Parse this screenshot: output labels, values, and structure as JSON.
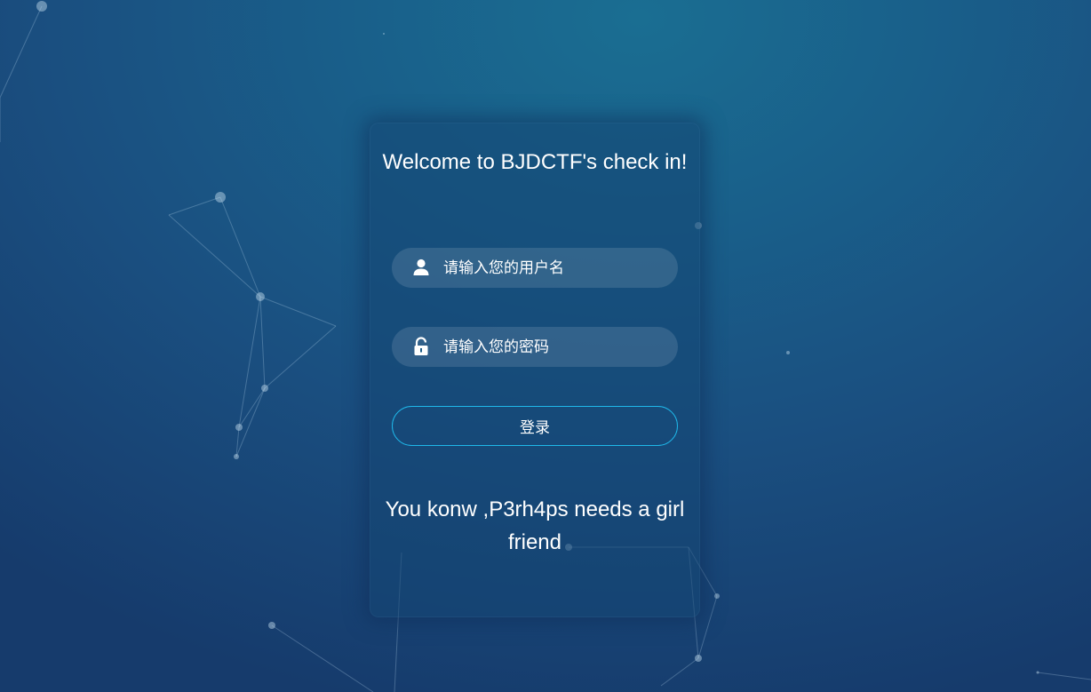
{
  "login_card": {
    "title": "Welcome to BJDCTF's check in!",
    "username": {
      "placeholder": "请输入您的用户名",
      "value": "",
      "icon": "user-icon"
    },
    "password": {
      "placeholder": "请输入您的密码",
      "value": "",
      "icon": "unlock-icon"
    },
    "login_label": "登录",
    "hint": "You konw ,P3rh4ps needs a girl friend"
  },
  "colors": {
    "background_top": "#1a6e92",
    "background_bottom": "#163b6c",
    "button_border": "#1fb8ea",
    "text": "#ffffff"
  }
}
